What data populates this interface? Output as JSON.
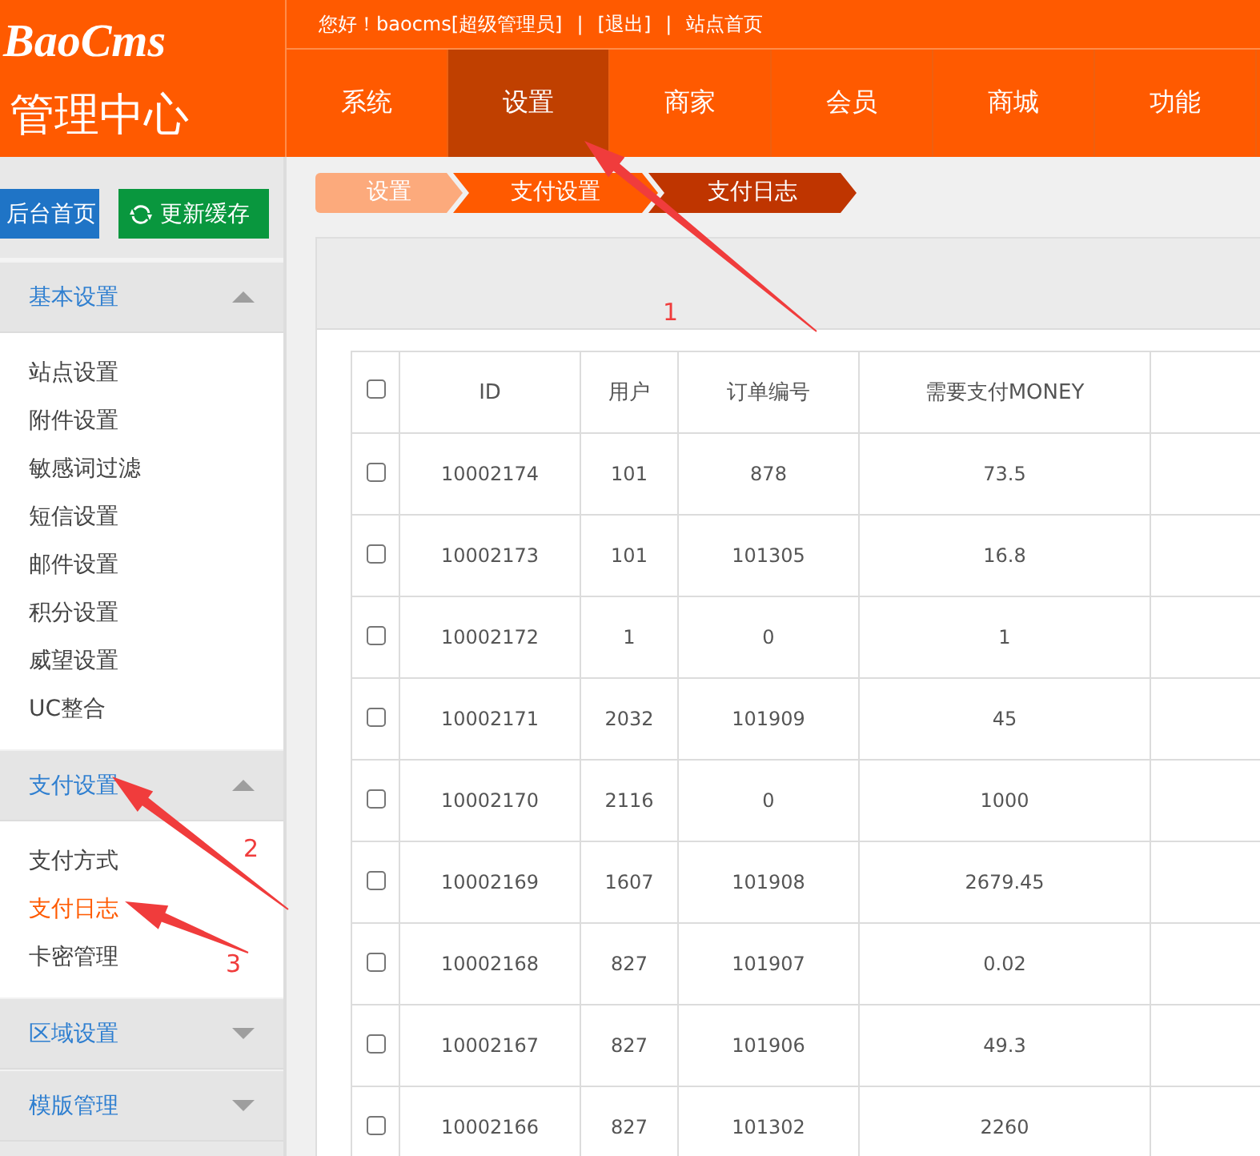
{
  "logo": {
    "brand": "BaoCms",
    "title": "管理中心"
  },
  "top_bar": {
    "greeting": "您好！baocms[超级管理员]",
    "links": [
      "[退出]",
      "站点首页"
    ],
    "separator": "|"
  },
  "nav_tabs": [
    {
      "label": "系统",
      "selected": false
    },
    {
      "label": "设置",
      "selected": true
    },
    {
      "label": "商家",
      "selected": false
    },
    {
      "label": "会员",
      "selected": false
    },
    {
      "label": "商城",
      "selected": false
    },
    {
      "label": "功能",
      "selected": false
    }
  ],
  "sidebar": {
    "buttons": [
      {
        "label": "后台首页",
        "kind": "home"
      },
      {
        "label": "更新缓存",
        "kind": "refresh"
      }
    ],
    "sections": [
      {
        "title": "基本设置",
        "expanded": true,
        "items": [
          {
            "label": "站点设置",
            "selected": false
          },
          {
            "label": "附件设置",
            "selected": false
          },
          {
            "label": "敏感词过滤",
            "selected": false
          },
          {
            "label": "短信设置",
            "selected": false
          },
          {
            "label": "邮件设置",
            "selected": false
          },
          {
            "label": "积分设置",
            "selected": false
          },
          {
            "label": "威望设置",
            "selected": false
          },
          {
            "label": "UC整合",
            "selected": false
          }
        ]
      },
      {
        "title": "支付设置",
        "expanded": true,
        "items": [
          {
            "label": "支付方式",
            "selected": false
          },
          {
            "label": "支付日志",
            "selected": true
          },
          {
            "label": "卡密管理",
            "selected": false
          }
        ]
      },
      {
        "title": "区域设置",
        "expanded": false
      },
      {
        "title": "模版管理",
        "expanded": false
      }
    ]
  },
  "breadcrumb": [
    "设置",
    "支付设置",
    "支付日志"
  ],
  "table": {
    "columns": [
      "ID",
      "用户",
      "订单编号",
      "需要支付MONEY"
    ],
    "select_all": {
      "checked": false
    },
    "rows": [
      {
        "checked": false,
        "cells": [
          "10002174",
          "101",
          "878",
          "73.5"
        ]
      },
      {
        "checked": false,
        "cells": [
          "10002173",
          "101",
          "101305",
          "16.8"
        ]
      },
      {
        "checked": false,
        "cells": [
          "10002172",
          "1",
          "0",
          "1"
        ]
      },
      {
        "checked": false,
        "cells": [
          "10002171",
          "2032",
          "101909",
          "45"
        ]
      },
      {
        "checked": false,
        "cells": [
          "10002170",
          "2116",
          "0",
          "1000"
        ]
      },
      {
        "checked": false,
        "cells": [
          "10002169",
          "1607",
          "101908",
          "2679.45"
        ]
      },
      {
        "checked": false,
        "cells": [
          "10002168",
          "827",
          "101907",
          "0.02"
        ]
      },
      {
        "checked": false,
        "cells": [
          "10002167",
          "827",
          "101906",
          "49.3"
        ]
      },
      {
        "checked": false,
        "cells": [
          "10002166",
          "827",
          "101302",
          "2260"
        ]
      }
    ]
  },
  "annotations": [
    "1",
    "2",
    "3"
  ]
}
